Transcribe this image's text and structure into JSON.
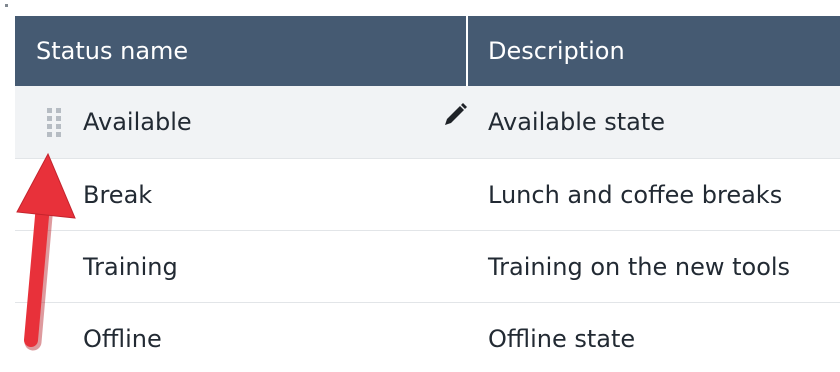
{
  "table": {
    "headers": {
      "status_name": "Status name",
      "description": "Description"
    },
    "rows": [
      {
        "name": "Available",
        "description": "Available state",
        "selected": true
      },
      {
        "name": "Break",
        "description": "Lunch and coffee breaks",
        "selected": false
      },
      {
        "name": "Training",
        "description": "Training on the new tools",
        "selected": false
      },
      {
        "name": "Offline",
        "description": "Offline state",
        "selected": false
      }
    ]
  },
  "icons": {
    "drag": "drag-handle-icon",
    "edit": "pencil-icon",
    "annotation": "red-arrow-annotation"
  },
  "colors": {
    "header_bg": "#455a72",
    "header_text": "#ffffff",
    "selected_row_bg": "#f1f3f5",
    "row_divider": "#e2e5e8",
    "annotation_arrow": "#e8313a"
  }
}
